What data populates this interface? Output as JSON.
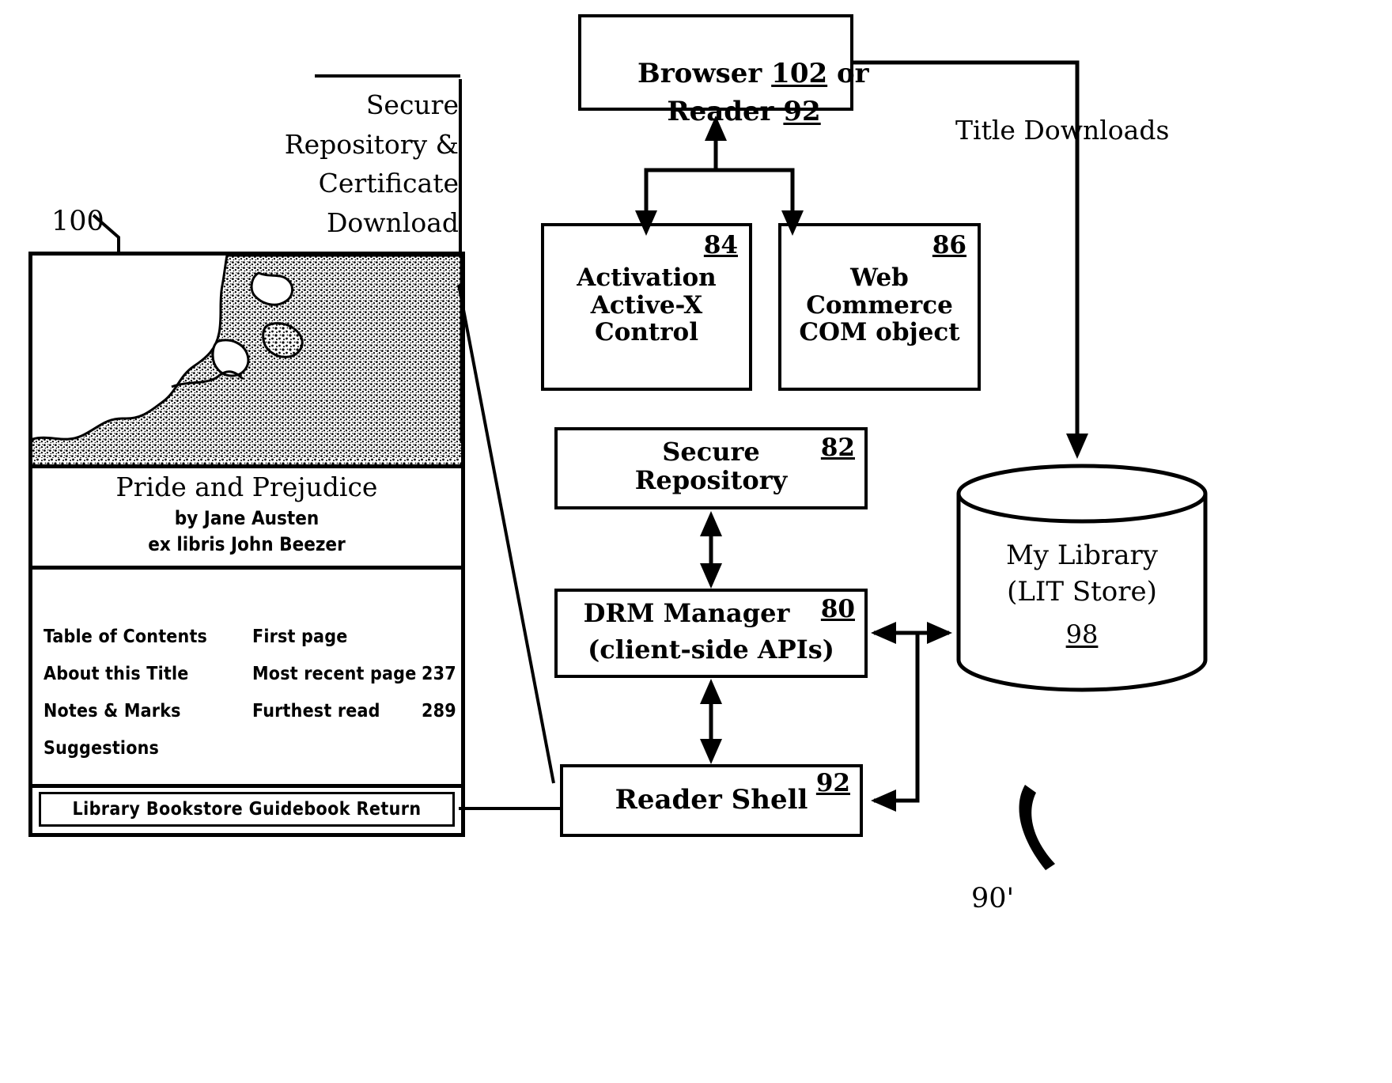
{
  "figure": {
    "label_90": "90'",
    "label_100": "100",
    "title_downloads": "Title Downloads",
    "secure_repo_callout": "Secure\nRepository &\nCertificate\nDownload"
  },
  "boxes": [
    {
      "id": "browser",
      "name": "browser-reader-box",
      "lines": "Browser 102 or\nReader 92",
      "line1a": "Browser ",
      "ref1": "102",
      "line1b": " or",
      "line2a": "Reader ",
      "ref2": "92"
    },
    {
      "id": "activation",
      "name": "activation-activex-control-box",
      "text": "Activation\nActive-X\nControl",
      "ref": "84"
    },
    {
      "id": "webcom",
      "name": "web-commerce-com-object-box",
      "text": "Web\nCommerce\nCOM object",
      "ref": "86"
    },
    {
      "id": "securerepo",
      "name": "secure-repository-box",
      "text": "Secure\nRepository",
      "ref": "82"
    },
    {
      "id": "drm",
      "name": "drm-manager-box",
      "text": "DRM Manager\n(client-side APIs)",
      "line1": "DRM Manager",
      "line2": "(client-side APIs)",
      "ref": "80"
    },
    {
      "id": "shell",
      "name": "reader-shell-box",
      "text": "Reader Shell",
      "ref": "92"
    }
  ],
  "cylinder": {
    "name": "my-library-lit-store-cylinder",
    "line1": "My Library",
    "line2": "(LIT Store)",
    "ref": "98"
  },
  "book": {
    "title": "Pride and Prejudice",
    "author": "by Jane Austen",
    "owner": "ex libris John Beezer",
    "menu_left": [
      "Table of Contents",
      "About this Title",
      "Notes & Marks",
      "Suggestions"
    ],
    "menu_right": [
      {
        "label": "First page",
        "value": ""
      },
      {
        "label": "Most recent page",
        "value": "237"
      },
      {
        "label": "Furthest read",
        "value": "289"
      }
    ],
    "bottom_bar": "Library Bookstore Guidebook Return"
  },
  "colors": {
    "ink": "#000000",
    "paper": "#ffffff"
  }
}
